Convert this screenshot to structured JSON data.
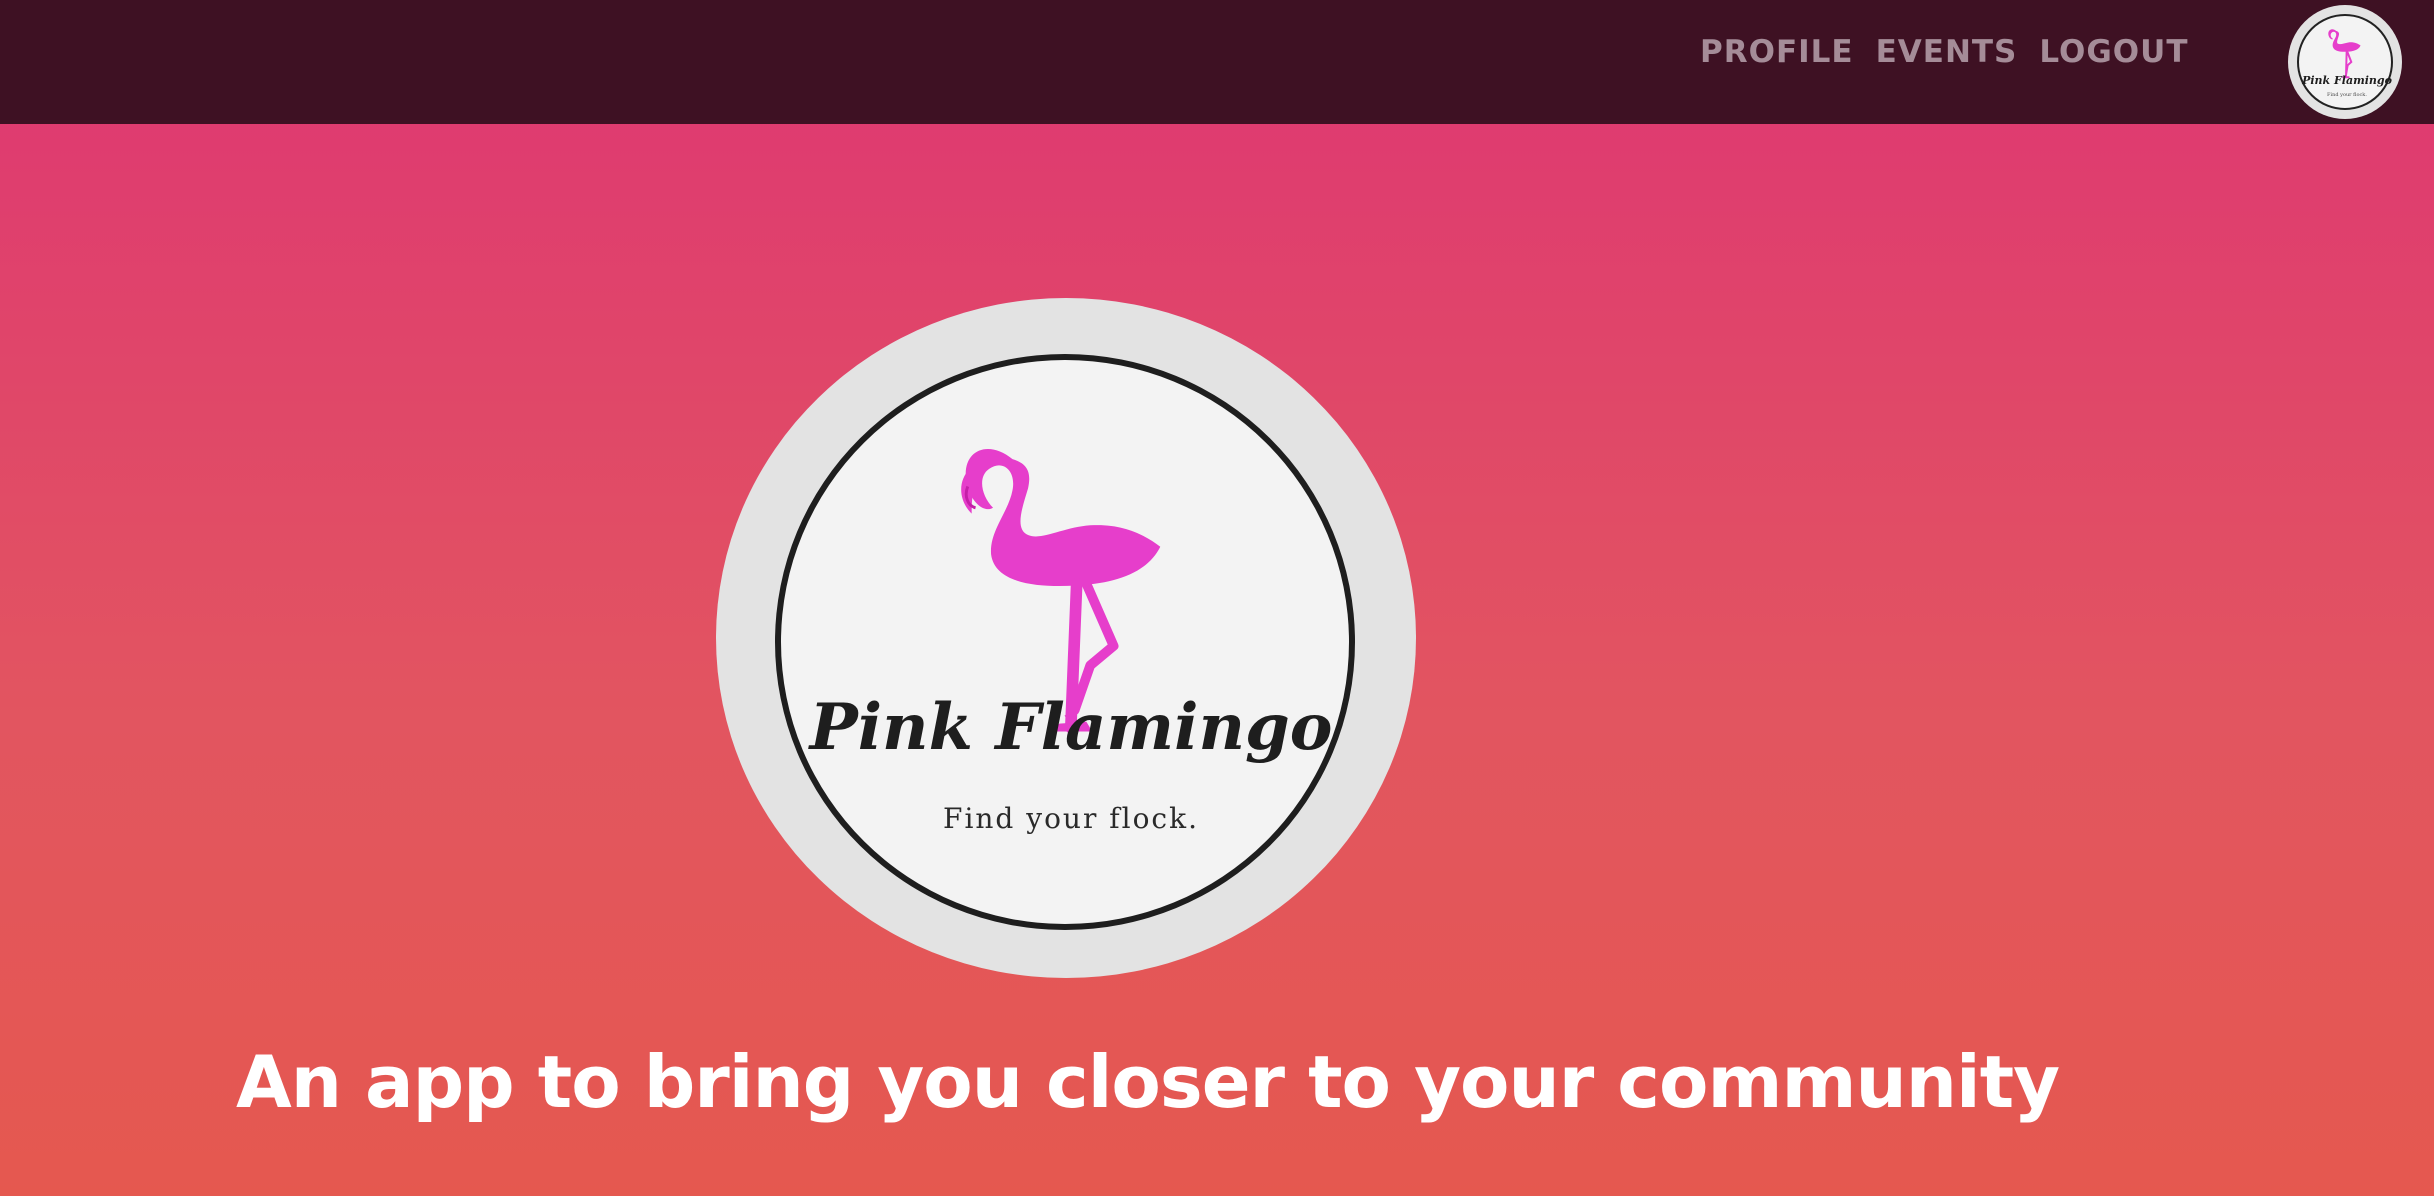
{
  "nav": {
    "links": [
      "PROFILE",
      "EVENTS",
      "LOGOUT"
    ],
    "logo_icon": "pink-flamingo-logo",
    "logo_name": "Pink Flamingo",
    "logo_tagline": "Find your flock."
  },
  "hero": {
    "logo_icon": "pink-flamingo-logo",
    "brand_name": "Pink Flamingo",
    "tagline": "Find your flock.",
    "headline": "An app to bring you closer to your community"
  },
  "colors": {
    "navbar_bg": "#3e1123",
    "nav_link": "#a58c98",
    "gradient_top": "#de3673",
    "gradient_bottom": "#e5584f",
    "flamingo": "#e63ecb",
    "headline_text": "#ffffff"
  }
}
